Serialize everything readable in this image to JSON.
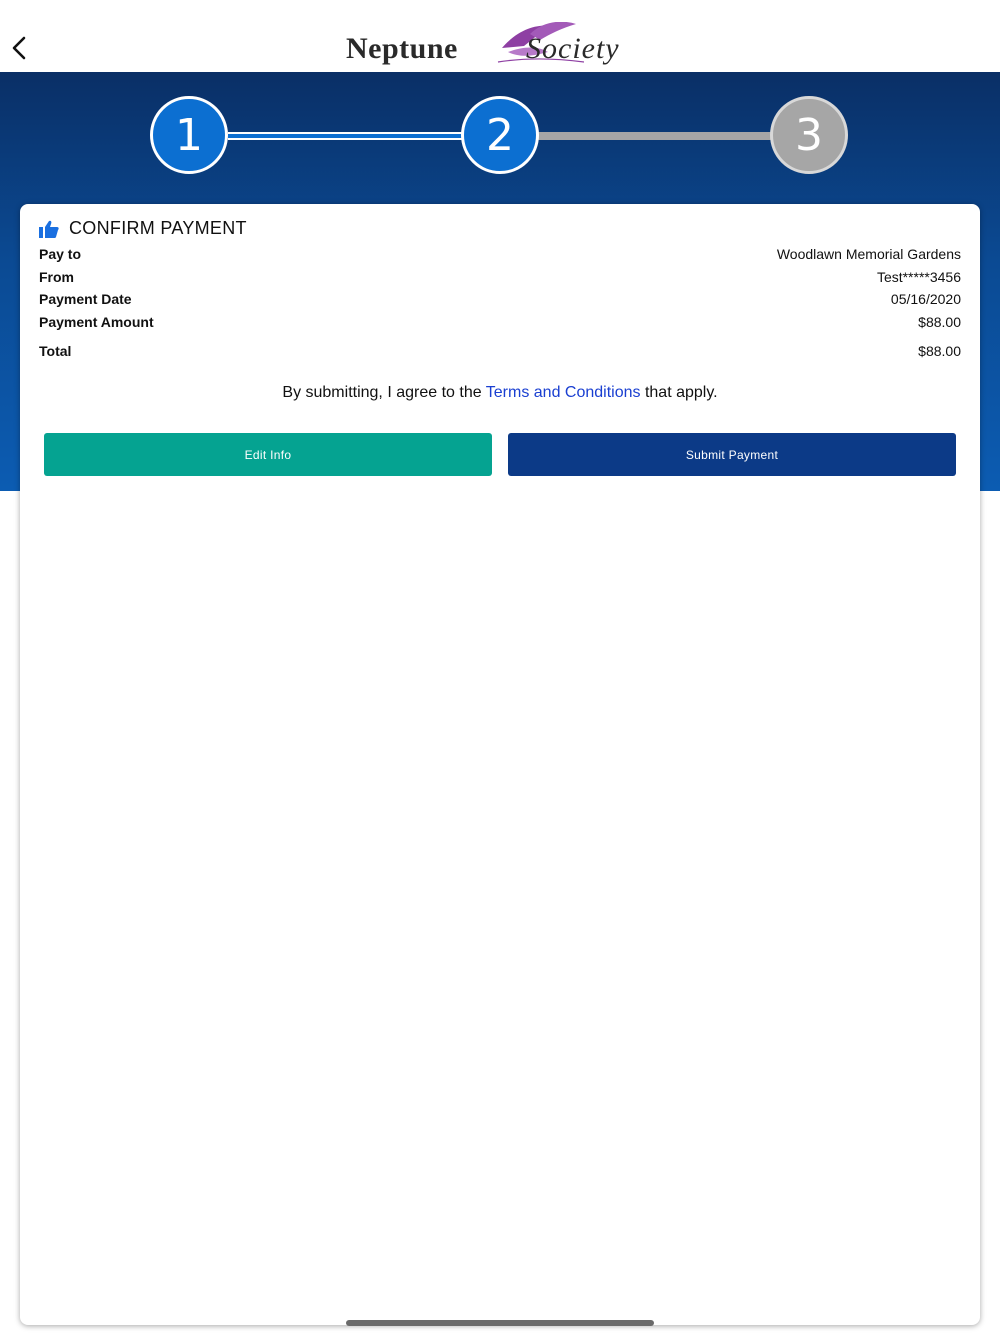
{
  "header": {
    "logo_word1": "Neptune",
    "logo_word2": "Society",
    "back_icon": "chevron-left-icon"
  },
  "stepper": {
    "steps": [
      "1",
      "2",
      "3"
    ],
    "current_step": 2,
    "active_color": "#0c6fd1",
    "inactive_color": "#a6a6a6"
  },
  "confirm": {
    "title": "CONFIRM PAYMENT",
    "title_icon": "thumbs-up-icon",
    "rows": [
      {
        "label": "Pay to",
        "value": "Woodlawn Memorial Gardens"
      },
      {
        "label": "From",
        "value": "Test*****3456"
      },
      {
        "label": "Payment Date",
        "value": "05/16/2020"
      },
      {
        "label": "Payment Amount",
        "value": "$88.00"
      }
    ],
    "total": {
      "label": "Total",
      "value": "$88.00"
    },
    "agree_prefix": "By submitting, I agree to the ",
    "agree_link": "Terms and Conditions",
    "agree_suffix": " that apply."
  },
  "actions": {
    "edit_label": "Edit Info",
    "submit_label": "Submit Payment",
    "edit_color": "#05a391",
    "submit_color": "#0c3a87"
  }
}
